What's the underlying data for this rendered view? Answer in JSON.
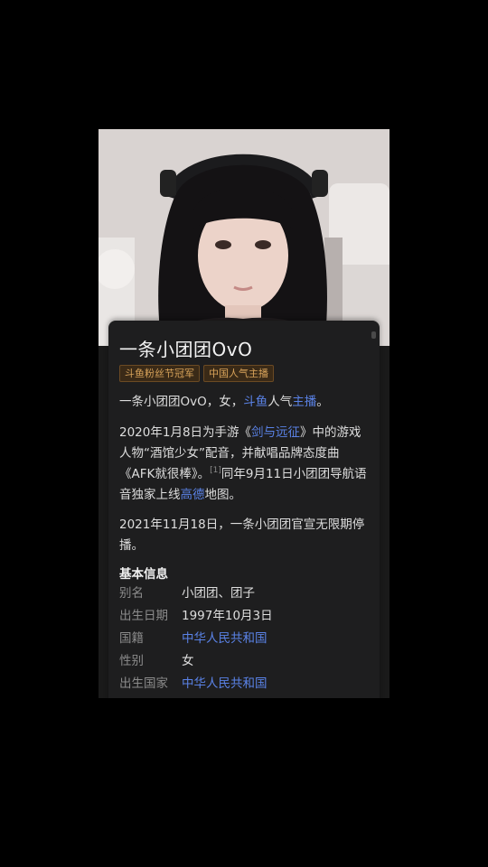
{
  "title": "一条小团团OvO",
  "tags": [
    "斗鱼粉丝节冠军",
    "中国人气主播"
  ],
  "intro": {
    "p1": [
      "一条小团团OvO，女，",
      "斗鱼",
      "人气",
      "主播",
      "。"
    ],
    "p2": [
      "2020年1月8日为手游《",
      "剑与远征",
      "》中的游戏人物“酒馆少女”配音，并献唱品牌态度曲《AFK就很棒》。",
      "[1]",
      "同年9月11日小团团导航语音独家上线",
      "高德",
      "地图。"
    ],
    "p3": "2021年11月18日，一条小团团官宣无限期停播。"
  },
  "basic_info": {
    "heading": "基本信息",
    "rows": [
      {
        "key": "别名",
        "value": "小团团、团子"
      },
      {
        "key": "出生日期",
        "value": "1997年10月3日"
      },
      {
        "key": "国籍",
        "value": "中华人民共和国"
      },
      {
        "key": "性别",
        "value": "女"
      },
      {
        "key": "出生国家",
        "value": "中华人民共和国"
      }
    ]
  },
  "colors": {
    "link": "#5a82e6",
    "tag_text": "#d8a35a",
    "card_bg": "#1e1e1f"
  }
}
